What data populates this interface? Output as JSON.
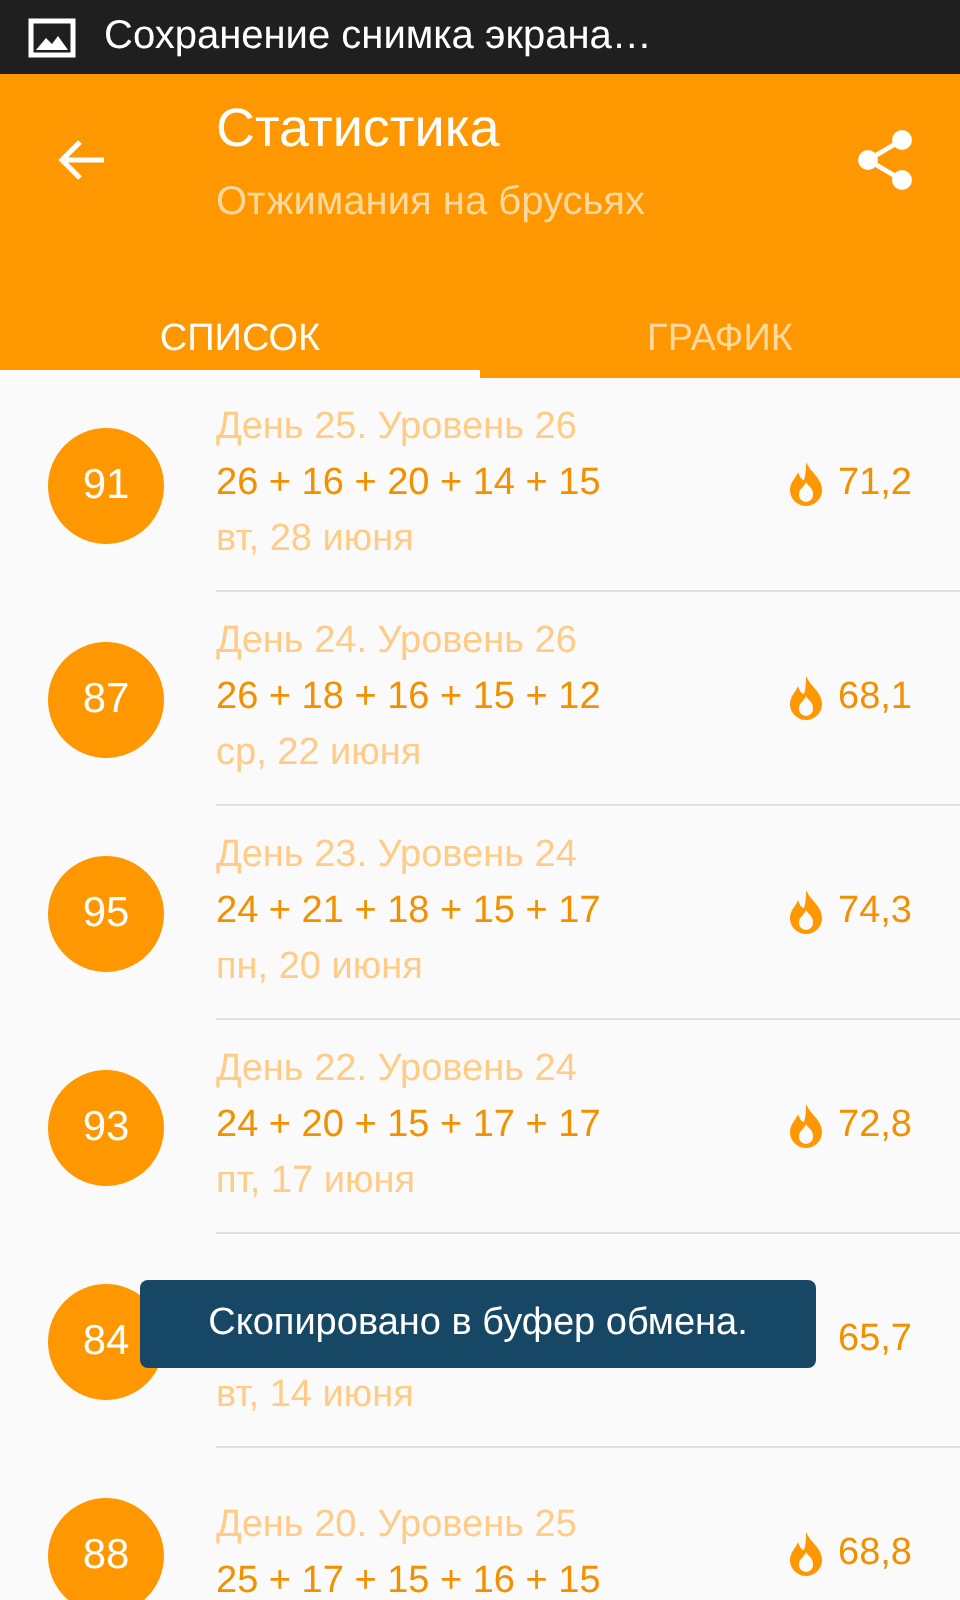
{
  "status_bar": {
    "notification": "Сохранение снимка экрана…"
  },
  "toolbar": {
    "title": "Статистика",
    "subtitle": "Отжимания на брусьях"
  },
  "tabs": [
    {
      "label": "СПИСОК",
      "selected": true
    },
    {
      "label": "ГРАФИК",
      "selected": false
    }
  ],
  "rows": [
    {
      "score": "91",
      "day": "День 25.  Уровень 26",
      "sets": "26 + 16 + 20 + 14 + 15",
      "date": "вт, 28 июня",
      "calories": "71,2",
      "flame": true
    },
    {
      "score": "87",
      "day": "День 24.  Уровень 26",
      "sets": "26 + 18 + 16 + 15 + 12",
      "date": "ср, 22 июня",
      "calories": "68,1",
      "flame": true
    },
    {
      "score": "95",
      "day": "День 23.  Уровень 24",
      "sets": "24 + 21 + 18 + 15 + 17",
      "date": "пн, 20 июня",
      "calories": "74,3",
      "flame": true
    },
    {
      "score": "93",
      "day": "День 22.  Уровень 24",
      "sets": "24 + 20 + 15 + 17 + 17",
      "date": "пт, 17 июня",
      "calories": "72,8",
      "flame": true
    },
    {
      "score": "84",
      "date": "вт, 14 июня",
      "calories": "65,7",
      "flame": false
    },
    {
      "score": "88",
      "day": "День 20.  Уровень 25",
      "sets": "25 + 17 + 15 + 16 + 15",
      "calories": "68,8",
      "flame": true
    }
  ],
  "toast": {
    "text": "Скопировано в буфер обмена."
  }
}
